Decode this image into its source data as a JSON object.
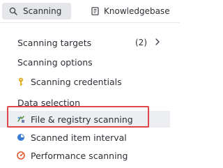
{
  "tabs": [
    {
      "label": "Scanning",
      "icon": "search-icon",
      "active": true
    },
    {
      "label": "Knowledgebase",
      "icon": "book-icon",
      "active": false
    }
  ],
  "menu": {
    "targets": {
      "label": "Scanning targets",
      "count": "(2)"
    },
    "options_heading": "Scanning options",
    "credentials_label": "Scanning credentials",
    "data_heading": "Data selection",
    "items": [
      {
        "label": "File & registry scanning",
        "icon": "file-registry-icon",
        "selected": true
      },
      {
        "label": "Scanned item interval",
        "icon": "interval-icon",
        "selected": false
      },
      {
        "label": "Performance scanning",
        "icon": "performance-gauge-icon",
        "selected": false
      }
    ]
  },
  "colors": {
    "highlight_border": "#e0454a",
    "active_tab_bg": "#e4e6ea",
    "selected_row_bg": "#eceef1",
    "key_icon": "#e0a81c",
    "interval_icon": "#3a7bd5",
    "performance_icon": "#e2572b"
  }
}
